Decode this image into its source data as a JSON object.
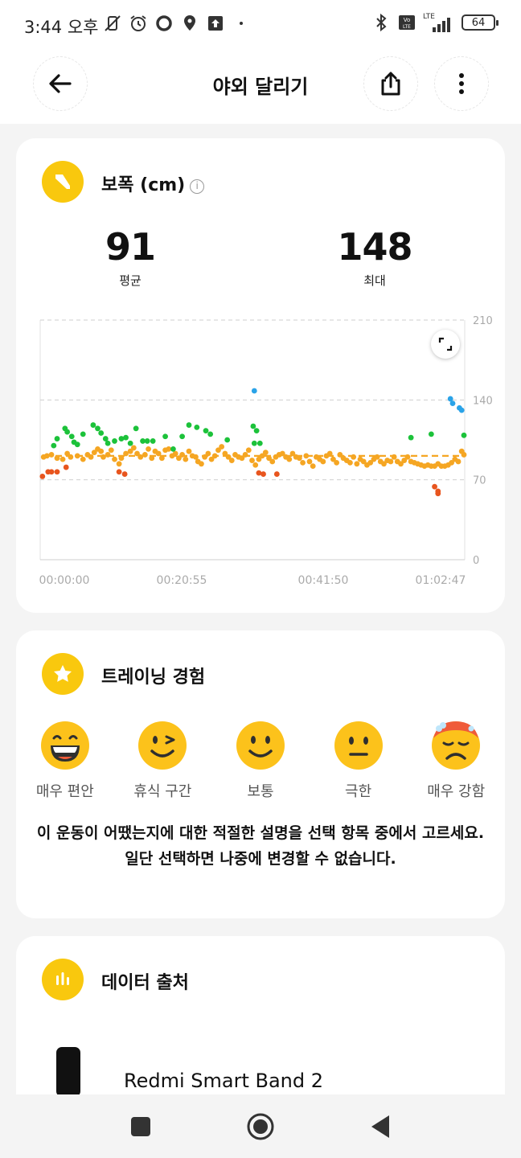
{
  "status_bar": {
    "time": "3:44 오후",
    "battery": "64",
    "network_label": "LTE"
  },
  "header": {
    "title": "야외 달리기",
    "back_icon": "arrow-left-icon",
    "share_icon": "share-icon",
    "more_icon": "more-vertical-icon"
  },
  "stride_card": {
    "title": "보폭 (cm)",
    "info_icon": "i",
    "average_value": "91",
    "average_label": "평균",
    "max_value": "148",
    "max_label": "최대"
  },
  "chart_data": {
    "type": "scatter",
    "title": "",
    "xlabel": "",
    "ylabel": "",
    "ylim": [
      0,
      210
    ],
    "yticks": [
      "210",
      "140",
      "70",
      "0"
    ],
    "xticks": [
      "00:00:00",
      "00:20:55",
      "00:41:50",
      "01:02:47"
    ],
    "xlim_seconds": [
      0,
      3767
    ],
    "average_line": 91,
    "grid": true,
    "colors": {
      "orange": "#f5a623",
      "green": "#1cc23a",
      "red": "#e8551e",
      "blue": "#2aa3e8",
      "avg": "#f5a623"
    },
    "series": [
      {
        "color_key": "orange",
        "points": [
          [
            30,
            90
          ],
          [
            60,
            91
          ],
          [
            100,
            92
          ],
          [
            150,
            89
          ],
          [
            200,
            88
          ],
          [
            240,
            93
          ],
          [
            270,
            90
          ],
          [
            330,
            91
          ],
          [
            380,
            88
          ],
          [
            420,
            92
          ],
          [
            450,
            90
          ],
          [
            480,
            94
          ],
          [
            510,
            97
          ],
          [
            540,
            95
          ],
          [
            560,
            90
          ],
          [
            600,
            92
          ],
          [
            630,
            96
          ],
          [
            660,
            88
          ],
          [
            700,
            84
          ],
          [
            720,
            89
          ],
          [
            760,
            93
          ],
          [
            800,
            95
          ],
          [
            830,
            98
          ],
          [
            860,
            93
          ],
          [
            890,
            90
          ],
          [
            930,
            92
          ],
          [
            960,
            97
          ],
          [
            990,
            89
          ],
          [
            1020,
            95
          ],
          [
            1050,
            93
          ],
          [
            1080,
            89
          ],
          [
            1110,
            96
          ],
          [
            1140,
            97
          ],
          [
            1170,
            91
          ],
          [
            1200,
            93
          ],
          [
            1230,
            89
          ],
          [
            1260,
            92
          ],
          [
            1290,
            88
          ],
          [
            1320,
            95
          ],
          [
            1350,
            91
          ],
          [
            1380,
            90
          ],
          [
            1400,
            86
          ],
          [
            1430,
            84
          ],
          [
            1460,
            90
          ],
          [
            1490,
            93
          ],
          [
            1520,
            88
          ],
          [
            1550,
            91
          ],
          [
            1580,
            96
          ],
          [
            1610,
            99
          ],
          [
            1640,
            93
          ],
          [
            1670,
            90
          ],
          [
            1700,
            87
          ],
          [
            1730,
            92
          ],
          [
            1760,
            90
          ],
          [
            1790,
            89
          ],
          [
            1820,
            92
          ],
          [
            1850,
            96
          ],
          [
            1880,
            87
          ],
          [
            1910,
            83
          ],
          [
            1940,
            88
          ],
          [
            1970,
            91
          ],
          [
            2000,
            94
          ],
          [
            2030,
            89
          ],
          [
            2060,
            86
          ],
          [
            2090,
            90
          ],
          [
            2120,
            92
          ],
          [
            2150,
            93
          ],
          [
            2180,
            90
          ],
          [
            2210,
            88
          ],
          [
            2240,
            93
          ],
          [
            2270,
            90
          ],
          [
            2300,
            89
          ],
          [
            2330,
            85
          ],
          [
            2360,
            91
          ],
          [
            2390,
            86
          ],
          [
            2420,
            82
          ],
          [
            2450,
            90
          ],
          [
            2480,
            88
          ],
          [
            2510,
            86
          ],
          [
            2540,
            91
          ],
          [
            2570,
            93
          ],
          [
            2600,
            88
          ],
          [
            2630,
            85
          ],
          [
            2660,
            92
          ],
          [
            2690,
            89
          ],
          [
            2720,
            87
          ],
          [
            2750,
            85
          ],
          [
            2780,
            90
          ],
          [
            2810,
            84
          ],
          [
            2840,
            88
          ],
          [
            2870,
            86
          ],
          [
            2900,
            83
          ],
          [
            2930,
            85
          ],
          [
            2960,
            88
          ],
          [
            2990,
            90
          ],
          [
            3020,
            86
          ],
          [
            3050,
            84
          ],
          [
            3080,
            87
          ],
          [
            3110,
            86
          ],
          [
            3140,
            90
          ],
          [
            3170,
            86
          ],
          [
            3200,
            84
          ],
          [
            3230,
            87
          ],
          [
            3260,
            90
          ],
          [
            3290,
            86
          ],
          [
            3320,
            85
          ],
          [
            3350,
            84
          ],
          [
            3380,
            83
          ],
          [
            3410,
            82
          ],
          [
            3440,
            83
          ],
          [
            3470,
            82
          ],
          [
            3500,
            82
          ],
          [
            3530,
            84
          ],
          [
            3560,
            82
          ],
          [
            3590,
            82
          ],
          [
            3620,
            83
          ],
          [
            3650,
            85
          ],
          [
            3680,
            88
          ],
          [
            3710,
            86
          ],
          [
            3740,
            95
          ],
          [
            3760,
            92
          ]
        ]
      },
      {
        "color_key": "green",
        "points": [
          [
            120,
            100
          ],
          [
            150,
            106
          ],
          [
            220,
            115
          ],
          [
            240,
            112
          ],
          [
            280,
            108
          ],
          [
            300,
            103
          ],
          [
            330,
            101
          ],
          [
            380,
            110
          ],
          [
            470,
            118
          ],
          [
            510,
            115
          ],
          [
            540,
            111
          ],
          [
            580,
            106
          ],
          [
            600,
            102
          ],
          [
            660,
            104
          ],
          [
            720,
            106
          ],
          [
            760,
            107
          ],
          [
            800,
            102
          ],
          [
            850,
            115
          ],
          [
            910,
            104
          ],
          [
            950,
            104
          ],
          [
            1000,
            104
          ],
          [
            1110,
            108
          ],
          [
            1180,
            97
          ],
          [
            1260,
            108
          ],
          [
            1320,
            118
          ],
          [
            1390,
            116
          ],
          [
            1470,
            113
          ],
          [
            1510,
            110
          ],
          [
            1660,
            105
          ],
          [
            1890,
            117
          ],
          [
            1920,
            113
          ],
          [
            1900,
            102
          ],
          [
            1950,
            102
          ],
          [
            3290,
            107
          ],
          [
            3470,
            110
          ],
          [
            3760,
            109
          ]
        ]
      },
      {
        "color_key": "red",
        "points": [
          [
            20,
            73
          ],
          [
            70,
            77
          ],
          [
            100,
            77
          ],
          [
            150,
            77
          ],
          [
            230,
            81
          ],
          [
            700,
            77
          ],
          [
            750,
            75
          ],
          [
            1940,
            76
          ],
          [
            1980,
            75
          ],
          [
            2100,
            75
          ],
          [
            3500,
            64
          ],
          [
            3530,
            60
          ],
          [
            3530,
            58
          ]
        ]
      },
      {
        "color_key": "blue",
        "points": [
          [
            1900,
            148
          ],
          [
            3640,
            141
          ],
          [
            3660,
            137
          ],
          [
            3720,
            133
          ],
          [
            3740,
            131
          ]
        ]
      }
    ]
  },
  "training_card": {
    "title": "트레이닝 경험",
    "options": [
      {
        "label": "매우 편안",
        "icon": "grinning-face-icon"
      },
      {
        "label": "휴식 구간",
        "icon": "winking-face-icon"
      },
      {
        "label": "보통",
        "icon": "smiling-face-icon"
      },
      {
        "label": "극한",
        "icon": "neutral-face-icon"
      },
      {
        "label": "매우 강함",
        "icon": "exhausted-face-icon"
      }
    ],
    "description": "이 운동이 어땠는지에 대한 적절한 설명을 선택 항목 중에서 고르세요. 일단 선택하면 나중에 변경할 수 없습니다."
  },
  "source_card": {
    "title": "데이터 출처",
    "device_name": "Redmi Smart Band 2"
  },
  "nav_bar": {
    "recents_icon": "square-icon",
    "home_icon": "circle-home-icon",
    "back_icon": "triangle-back-icon"
  }
}
